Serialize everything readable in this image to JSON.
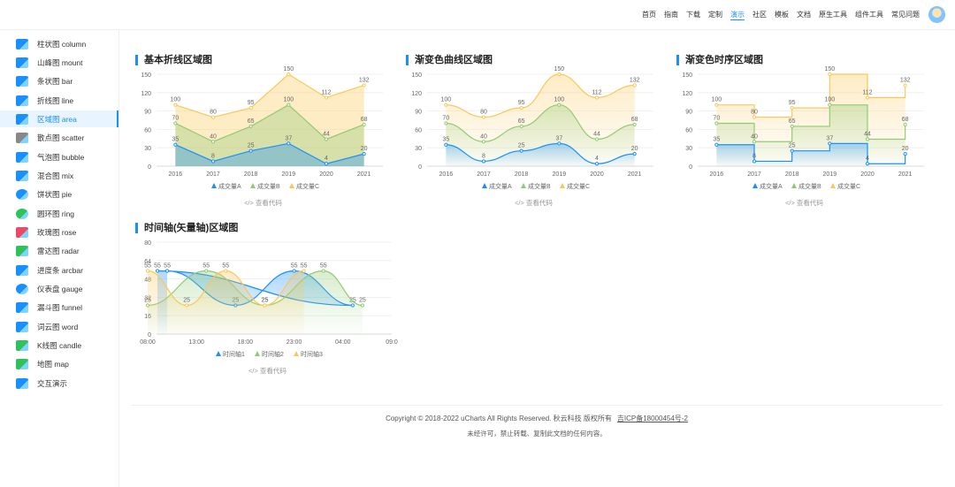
{
  "topnav": {
    "items": [
      "首页",
      "指南",
      "下载",
      "定制",
      "演示",
      "社区",
      "模板",
      "文档",
      "原生工具",
      "组件工具",
      "常见问题"
    ],
    "active_index": 4
  },
  "sidebar": {
    "items": [
      {
        "label": "柱状图  column",
        "icon": "bar-chart-icon"
      },
      {
        "label": "山峰图  mount",
        "icon": "mountain-chart-icon"
      },
      {
        "label": "条状图  bar",
        "icon": "horizontal-bar-icon"
      },
      {
        "label": "折线图  line",
        "icon": "line-chart-icon"
      },
      {
        "label": "区域图  area",
        "icon": "area-chart-icon"
      },
      {
        "label": "散点图  scatter",
        "icon": "scatter-chart-icon"
      },
      {
        "label": "气泡图  bubble",
        "icon": "bubble-chart-icon"
      },
      {
        "label": "混合图  mix",
        "icon": "mix-chart-icon"
      },
      {
        "label": "饼状图  pie",
        "icon": "pie-chart-icon"
      },
      {
        "label": "圆环图  ring",
        "icon": "ring-chart-icon"
      },
      {
        "label": "玫瑰图  rose",
        "icon": "rose-chart-icon"
      },
      {
        "label": "雷达图  radar",
        "icon": "radar-chart-icon"
      },
      {
        "label": "进度条  arcbar",
        "icon": "arcbar-icon"
      },
      {
        "label": "仪表盘  gauge",
        "icon": "gauge-icon"
      },
      {
        "label": "漏斗图  funnel",
        "icon": "funnel-icon"
      },
      {
        "label": "词云图  word",
        "icon": "word-cloud-icon"
      },
      {
        "label": "K线图  candle",
        "icon": "candle-chart-icon"
      },
      {
        "label": "地图  map",
        "icon": "map-icon"
      },
      {
        "label": "交互演示",
        "icon": "interactive-icon"
      }
    ],
    "active_index": 4
  },
  "colors": {
    "accent": "#1890ff",
    "seriesA": "#1890ff",
    "seriesB": "#91cb74",
    "seriesC": "#fac858"
  },
  "view_code_label": "</> 查看代码",
  "footer": {
    "copyright": "Copyright © 2018-2022 uCharts All Rights Reserved. 秋云科技 版权所有",
    "icp": "吉ICP备18000454号-2",
    "notice": "未经许可，禁止转载、复制此文档的任何内容。"
  },
  "chart_data": [
    {
      "type": "area",
      "title": "基本折线区域图",
      "categories": [
        "2016",
        "2017",
        "2018",
        "2019",
        "2020",
        "2021"
      ],
      "ylim": [
        0,
        150
      ],
      "yticks": [
        0,
        30,
        60,
        90,
        120,
        150
      ],
      "series": [
        {
          "name": "成交量A",
          "values": [
            35,
            8,
            25,
            37,
            4,
            20
          ]
        },
        {
          "name": "成交量B",
          "values": [
            70,
            40,
            65,
            100,
            44,
            68
          ]
        },
        {
          "name": "成交量C",
          "values": [
            100,
            80,
            95,
            150,
            112,
            132
          ]
        }
      ]
    },
    {
      "type": "area",
      "title": "渐变色曲线区域图",
      "categories": [
        "2016",
        "2017",
        "2018",
        "2019",
        "2020",
        "2021"
      ],
      "ylim": [
        0,
        150
      ],
      "yticks": [
        0,
        30,
        60,
        90,
        120,
        150
      ],
      "series": [
        {
          "name": "成交量A",
          "values": [
            35,
            8,
            25,
            37,
            4,
            20
          ]
        },
        {
          "name": "成交量B",
          "values": [
            70,
            40,
            65,
            100,
            44,
            68
          ]
        },
        {
          "name": "成交量C",
          "values": [
            100,
            80,
            95,
            150,
            112,
            132
          ]
        }
      ]
    },
    {
      "type": "area",
      "title": "渐变色时序区域图",
      "categories": [
        "2016",
        "2017",
        "2018",
        "2019",
        "2020",
        "2021"
      ],
      "ylim": [
        0,
        150
      ],
      "yticks": [
        0,
        30,
        60,
        90,
        120,
        150
      ],
      "series": [
        {
          "name": "成交量A",
          "values": [
            35,
            8,
            25,
            37,
            4,
            20
          ]
        },
        {
          "name": "成交量B",
          "values": [
            70,
            40,
            65,
            100,
            44,
            68
          ]
        },
        {
          "name": "成交量C",
          "values": [
            100,
            80,
            95,
            150,
            112,
            132
          ]
        }
      ]
    },
    {
      "type": "area",
      "title": "时间轴(矢量轴)区域图",
      "xticks": [
        "08:00",
        "13:00",
        "18:00",
        "23:00",
        "04:00",
        "09:0"
      ],
      "ylim": [
        0,
        80
      ],
      "yticks": [
        0,
        16,
        32,
        48,
        64,
        80
      ],
      "series": [
        {
          "name": "时间轴1",
          "x": [
            "10:00",
            "17:00",
            "23:00",
            "05:00",
            "09:00"
          ],
          "values": [
            55,
            25,
            55,
            25,
            55
          ]
        },
        {
          "name": "时间轴2",
          "x": [
            "08:00",
            "14:00",
            "20:00",
            "02:00",
            "06:00"
          ],
          "values": [
            25,
            55,
            25,
            55,
            25
          ]
        },
        {
          "name": "时间轴3",
          "x": [
            "08:00",
            "12:00",
            "16:00",
            "20:00",
            "00:00"
          ],
          "values": [
            55,
            25,
            55,
            25,
            55
          ]
        }
      ]
    }
  ]
}
